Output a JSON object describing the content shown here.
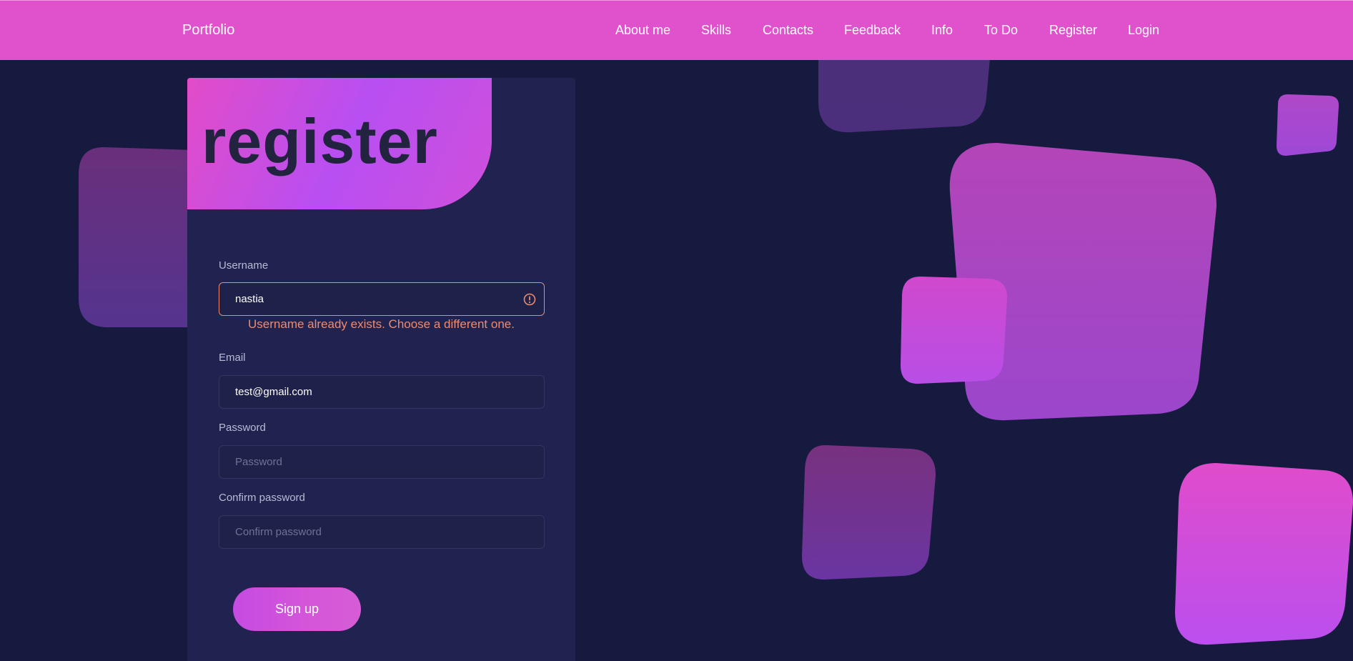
{
  "navbar": {
    "brand": "Portfolio",
    "links": [
      "About me",
      "Skills",
      "Contacts",
      "Feedback",
      "Info",
      "To Do",
      "Register",
      "Login"
    ]
  },
  "form": {
    "title": "register",
    "username": {
      "label": "Username",
      "value": "nastia",
      "error": "Username already exists. Choose a different one."
    },
    "email": {
      "label": "Email",
      "value": "test@gmail.com"
    },
    "password": {
      "label": "Password",
      "placeholder": "Password"
    },
    "confirm": {
      "label": "Confirm password",
      "placeholder": "Confirm password"
    },
    "submit_label": "Sign up"
  },
  "colors": {
    "navbar": "#e052cc",
    "background": "#171a3f",
    "card": "#20224f",
    "error": "#f08a6c",
    "accent": "#b84ff2"
  }
}
